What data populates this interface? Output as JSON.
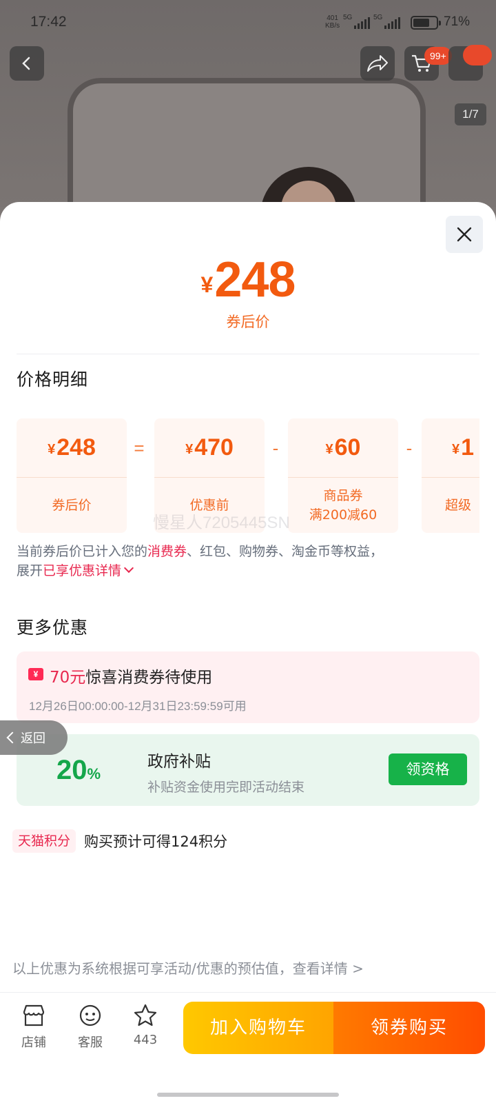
{
  "status_bar": {
    "time": "17:42",
    "net_speed_value": "401",
    "net_speed_unit": "KB/s",
    "signal1_label": "5G",
    "signal2_label": "5G",
    "battery_text": "71%",
    "battery_level": 0.71
  },
  "product_header": {
    "cart_badge": "99+",
    "image_pager": "1/7"
  },
  "sheet": {
    "price_yen": "¥",
    "price_value": "248",
    "price_label": "券后价",
    "breakdown_title": "价格明细",
    "breakdown": [
      {
        "value": "248",
        "label_lines": [
          "券后价"
        ]
      },
      {
        "value": "470",
        "label_lines": [
          "优惠前"
        ]
      },
      {
        "value": "60",
        "label_lines": [
          "商品券",
          "满200减60"
        ]
      },
      {
        "value": "1",
        "label_lines": [
          "超级"
        ]
      }
    ],
    "operators": [
      "=",
      "-",
      "-"
    ],
    "watermark": "慢星人7205445SN",
    "note": {
      "part1": "当前券后价已计入您的",
      "highlight1": "消费券",
      "part2": "、红包、购物券、淘金币等权益，",
      "part3": "展开",
      "highlight2": "已享优惠详情"
    },
    "more_title": "更多优惠",
    "coupon": {
      "icon_glyph": "¥",
      "amount": "70元",
      "desc": "惊喜消费券待使用",
      "period": "12月26日00:00:00-12月31日23:59:59可用"
    },
    "subsidy": {
      "percent": "20",
      "percent_sign": "%",
      "title": "政府补贴",
      "subtitle": "补贴资金使用完即活动结束",
      "button": "领资格"
    },
    "points": {
      "tag": "天猫积分",
      "text": "购买预计可得124积分"
    },
    "disclaimer": "以上优惠为系统根据可享活动/优惠的预估值，查看详情 >",
    "back_float": "返回"
  },
  "bottom_bar": {
    "store_label": "店铺",
    "service_label": "客服",
    "fav_count": "443",
    "add_cart": "加入购物车",
    "buy": "领券购买"
  },
  "colors": {
    "price_orange": "#f25a0f",
    "highlight_red": "#e8284f",
    "subsidy_green": "#17b249"
  }
}
